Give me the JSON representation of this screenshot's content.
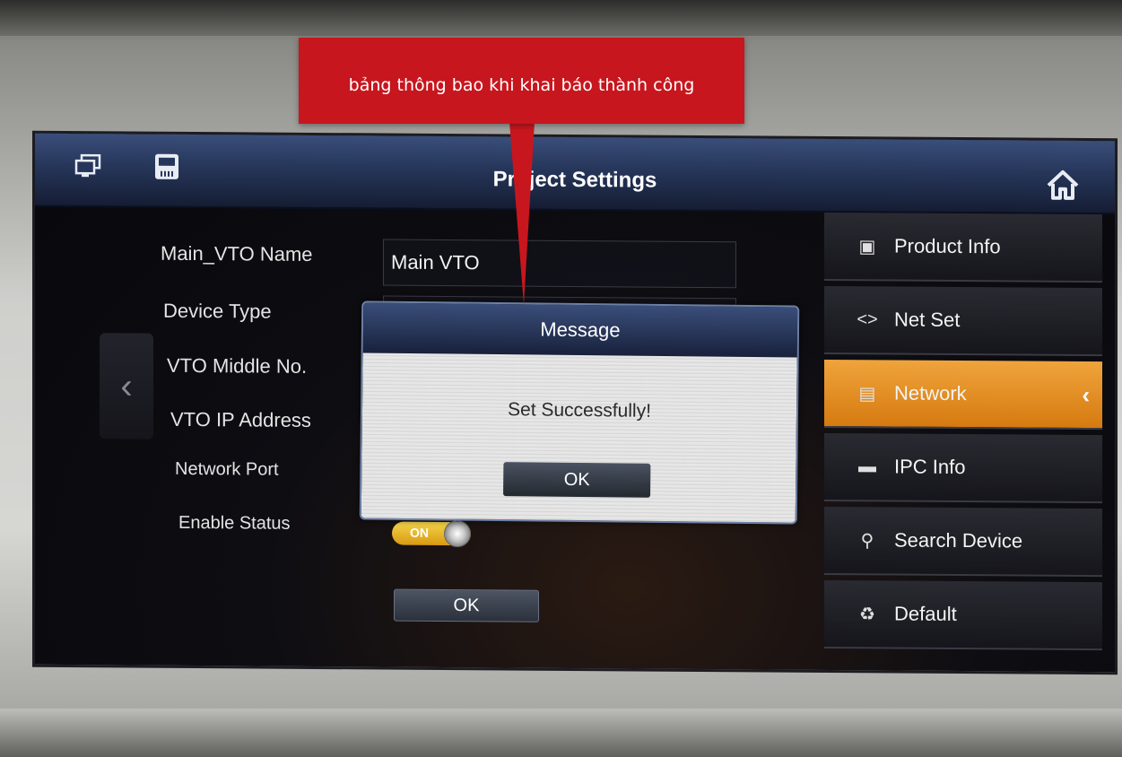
{
  "annotation": {
    "text": "bảng thông bao khi khai báo thành công",
    "color": "#c8161e"
  },
  "header": {
    "title": "Project Settings",
    "icons": [
      "monitor-icon",
      "sd-card-icon",
      "home-icon"
    ]
  },
  "form": {
    "fields": [
      {
        "label": "Main_VTO Name",
        "value": "Main VTO"
      },
      {
        "label": "Device Type",
        "value": ""
      },
      {
        "label": "VTO Middle No.",
        "value": ""
      },
      {
        "label": "VTO IP Address",
        "value": ""
      },
      {
        "label": "Network Port",
        "value": ""
      },
      {
        "label": "Enable Status",
        "value": "ON"
      }
    ],
    "ok_label": "OK"
  },
  "menu": {
    "items": [
      {
        "label": "Product Info",
        "icon": "monitor-icon",
        "active": false
      },
      {
        "label": "Net Set",
        "icon": "code-arrows-icon",
        "active": false
      },
      {
        "label": "Network",
        "icon": "network-icon",
        "active": true
      },
      {
        "label": "IPC Info",
        "icon": "camera-icon",
        "active": false
      },
      {
        "label": "Search Device",
        "icon": "search-device-icon",
        "active": false
      },
      {
        "label": "Default",
        "icon": "recycle-icon",
        "active": false
      }
    ],
    "active_color": "#e8901f"
  },
  "dialog": {
    "title": "Message",
    "message": "Set Successfully!",
    "ok_label": "OK"
  }
}
